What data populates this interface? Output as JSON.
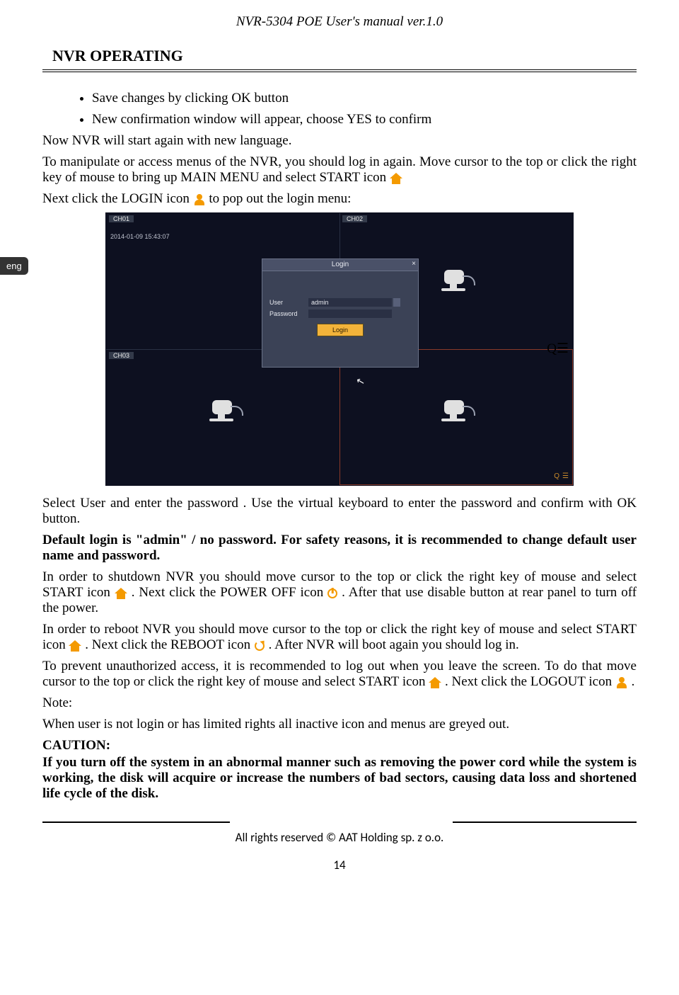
{
  "header": {
    "title": "NVR-5304 POE User's manual ver.1.0"
  },
  "section_title": "NVR OPERATING",
  "sidebar": {
    "lang": "eng"
  },
  "bullets": {
    "b1": "Save changes by clicking OK button",
    "b2": "New confirmation window will appear, choose YES to confirm"
  },
  "paras": {
    "p1": "Now NVR will start again with new language.",
    "p2a": "To manipulate or access menus of the NVR, you should log in again. Move cursor to the top or click the right key of mouse to bring up MAIN MENU and select START icon ",
    "p3a": "Next click the LOGIN icon ",
    "p3b": " to pop out the login menu:",
    "p4": "Select User and enter the password . Use the virtual keyboard to enter the password and confirm with OK button.",
    "p5": "Default login is \"admin\" / no password.  For safety reasons, it is recommended to change default user name and password.",
    "p6a": "In order to shutdown NVR you should move cursor to the top or click the right key of mouse and select START icon ",
    "p6b": " . Next click the POWER OFF icon ",
    "p6c": " . After that use disable button at rear panel to turn off the power.",
    "p7a": "In order to  reboot NVR you should move cursor to the top or click the right key of mouse and select START icon ",
    "p7b": " . Next click the REBOOT icon ",
    "p7c": " . After NVR will boot again you should log in.",
    "p8a": "To prevent unauthorized access, it is recommended to log out when you leave the screen. To do that move cursor to the top or click the right key of mouse and select START icon ",
    "p8b": ". Next click the LOGOUT icon ",
    "p8c": " .",
    "note_label": "Note:",
    "note_text": "When user is not login or has limited rights all inactive icon and menus are greyed out.",
    "caution_label": "CAUTION:",
    "caution_text": "If you turn off the system in an abnormal manner such as removing the power cord while the system is working, the disk will acquire or increase the numbers of bad sectors, causing data loss and shortened life cycle of the disk."
  },
  "screenshot": {
    "ch01": "CH01",
    "ch02": "CH02",
    "ch03": "CH03",
    "timestamp": "2014-01-09  15:43:07",
    "login_title": "Login",
    "user_label": "User",
    "user_value": "admin",
    "password_label": "Password",
    "login_button": "Login"
  },
  "footer": {
    "copyright": "All rights reserved © AAT Holding sp. z o.o.",
    "page": "14"
  }
}
